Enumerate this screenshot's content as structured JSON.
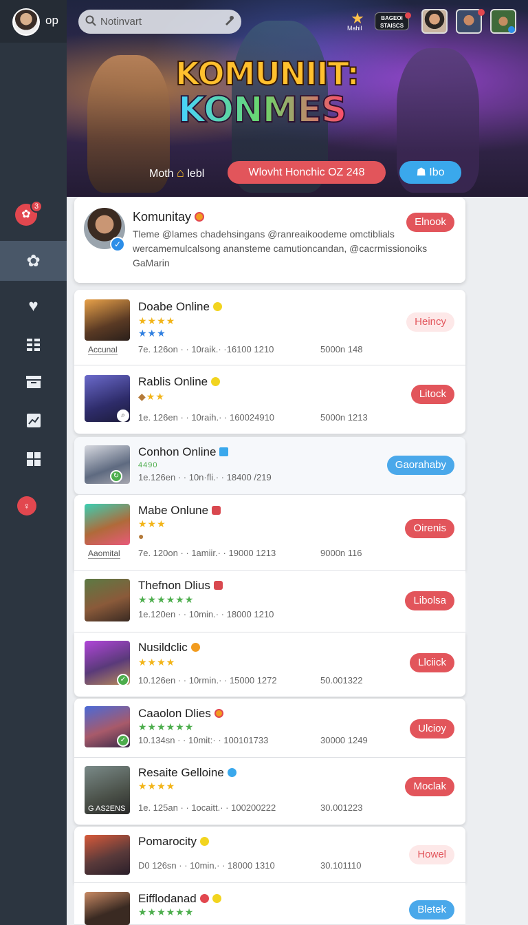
{
  "user": {
    "short_name": "op"
  },
  "search": {
    "placeholder": "Notinvart"
  },
  "header": {
    "star_label": "Mahil",
    "tag_line1": "BAGEOI",
    "tag_line2": "STAISCS"
  },
  "hero": {
    "title_line1": "KOMUNIIT:",
    "title_line2": "KONMES",
    "left_label": "Moth",
    "left_label_suffix": "lebl",
    "main_button": "Wlovht Honchic OZ 248",
    "side_button": "Ibo"
  },
  "sidebar": {
    "badge_count": "3"
  },
  "community": {
    "title": "Komunitay",
    "description": "Tleme @lames chadehsingans @ranreaikoodeme omctiblials wercamemulcalsong anansteme camutioncandan, @cacrmissionoiks GaMarin",
    "button": "Elnook"
  },
  "games": [
    {
      "name": "Doabe Online",
      "stars": "★★★★",
      "stars2": "★★★",
      "caption": "Accunal",
      "meta": "7e. 126on · · 10raik.· ·16100 1210",
      "right": "5000n 148",
      "button": "Heincy"
    },
    {
      "name": "Rablis Online",
      "stars": "★★",
      "meta": "1e. 126en · · 10raih.· · 160024910",
      "right": "5000n 1213",
      "button": "Litock"
    },
    {
      "name": "Conhon Online",
      "stars": "4490",
      "meta": "1e.126en · · 10n·fli.· · 18400 /219",
      "button": "Gaorahaby"
    },
    {
      "name": "Mabe Onlune",
      "stars": "★★★",
      "caption": "Aaomital",
      "meta": "7e. 120on · · 1amiir.· · 19000 1213",
      "right": "9000n 116",
      "button": "Oirenis"
    },
    {
      "name": "Thefnon Dlius",
      "stars": "★★★★★★",
      "meta": "1e.120en · · 10min.· · 18000 1210",
      "button": "Libolsa"
    },
    {
      "name": "Nusildclic",
      "stars": "★★★★",
      "meta": "10.126en · · 10rmin.· · 15000 1272",
      "right": "50.001322",
      "button": "Llciick"
    },
    {
      "name": "Caaolon Dlies",
      "stars": "★★★★★★",
      "meta": "10.134sn · · 10mit:· · 100101733",
      "right": "30000 1249",
      "button": "Ulcioy"
    },
    {
      "name": "Resaite Gelloine",
      "stars": "★★★★",
      "caption": "G AS2ENS",
      "meta": "1e. 125an · · 1ocaitt.· · 100200222",
      "right": "30.001223",
      "button": "Moclak"
    },
    {
      "name": "Pomarocity",
      "meta": "D0 126sn · · 10min.· · 18000 1310",
      "right": "30.101110",
      "button": "Howel"
    },
    {
      "name": "Eifflodanad",
      "stars": "★★★★★★",
      "button": "Bletek"
    }
  ]
}
